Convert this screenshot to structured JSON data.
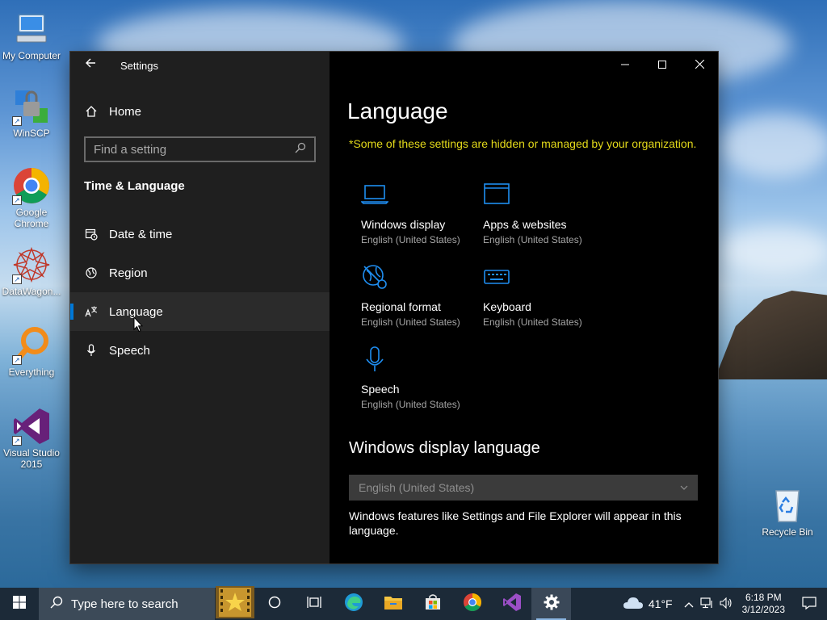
{
  "desktop": {
    "icons": [
      {
        "label": "My Computer"
      },
      {
        "label": "WinSCP"
      },
      {
        "label": "Google Chrome"
      },
      {
        "label": "DataWagon..."
      },
      {
        "label": "Everything"
      },
      {
        "label": "Visual Studio 2015"
      },
      {
        "label": "Recycle Bin"
      }
    ]
  },
  "window": {
    "title": "Settings",
    "back_icon": "back-arrow-icon"
  },
  "sidebar": {
    "home_label": "Home",
    "search_placeholder": "Find a setting",
    "section_heading": "Time & Language",
    "items": [
      {
        "label": "Date & time",
        "icon": "date-time-icon"
      },
      {
        "label": "Region",
        "icon": "region-icon"
      },
      {
        "label": "Language",
        "icon": "language-icon",
        "selected": true
      },
      {
        "label": "Speech",
        "icon": "microphone-icon"
      }
    ]
  },
  "main": {
    "title": "Language",
    "org_notice": "*Some of these settings are hidden or managed by your organization.",
    "tiles": [
      {
        "name": "Windows display",
        "sub": "English (United States)",
        "icon": "laptop-icon"
      },
      {
        "name": "Apps & websites",
        "sub": "English (United States)",
        "icon": "app-window-icon"
      },
      {
        "name": "Regional format",
        "sub": "English (United States)",
        "icon": "regional-format-icon"
      },
      {
        "name": "Keyboard",
        "sub": "English (United States)",
        "icon": "keyboard-icon"
      },
      {
        "name": "Speech",
        "sub": "English (United States)",
        "icon": "microphone-icon"
      }
    ],
    "display_language_heading": "Windows display language",
    "display_language_value": "English (United States)",
    "display_language_desc": "Windows features like Settings and File Explorer will appear in this language."
  },
  "taskbar": {
    "search_placeholder": "Type here to search",
    "weather": "41°F",
    "time": "6:18 PM",
    "date": "3/12/2023"
  },
  "colors": {
    "accent": "#0078d7",
    "notice": "#e2d81a",
    "sidebar_bg": "#1f1f1f",
    "main_bg": "#000000"
  }
}
